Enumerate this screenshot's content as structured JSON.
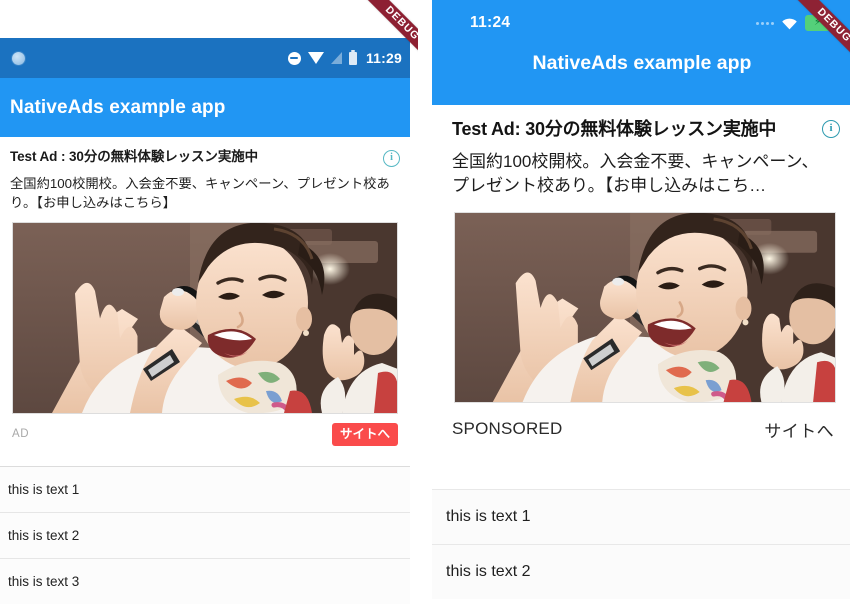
{
  "left_screen": {
    "status_bar": {
      "time": "11:29",
      "icons": [
        "dnd-icon",
        "wifi-icon",
        "signal-icon",
        "battery-icon"
      ],
      "indicator": "bluish-dot-icon",
      "background_color": "#1b72c0"
    },
    "app_bar": {
      "title": "NativeAds example app",
      "background_color": "#2196f3"
    },
    "ad_card": {
      "headline": "Test Ad : 30分の無料体験レッスン実施中",
      "body": "全国約100校開校。入会金不要、キャンペーン、プレゼント校あり。【お申し込みはこちら】",
      "info_icon": "info-icon",
      "image_alt": "woman-singing-karaoke-photo",
      "ad_label": "AD",
      "cta_label": "サイトへ",
      "cta_color": "#fa4b4b"
    },
    "list_items": [
      "this is text 1",
      "this is text 2",
      "this is text 3"
    ],
    "debug_banner": "DEBUG"
  },
  "right_screen": {
    "status_bar": {
      "time": "11:24",
      "icons": [
        "dots-icon",
        "wifi-icon",
        "battery-charging-icon"
      ],
      "battery_color": "#54d07a"
    },
    "app_bar": {
      "title": "NativeAds example app",
      "background_color": "#2196f3"
    },
    "ad_card": {
      "headline": "Test Ad: 30分の無料体験レッスン実施中",
      "body": "全国約100校開校。入会金不要、キャンペーン、プレゼント校あり。【お申し込みはこち…",
      "info_icon": "info-icon",
      "image_alt": "woman-singing-karaoke-photo",
      "ad_label": "SPONSORED",
      "cta_label": "サイトへ"
    },
    "list_items": [
      "this is text 1",
      "this is text 2"
    ],
    "debug_banner": "DEBUG"
  }
}
